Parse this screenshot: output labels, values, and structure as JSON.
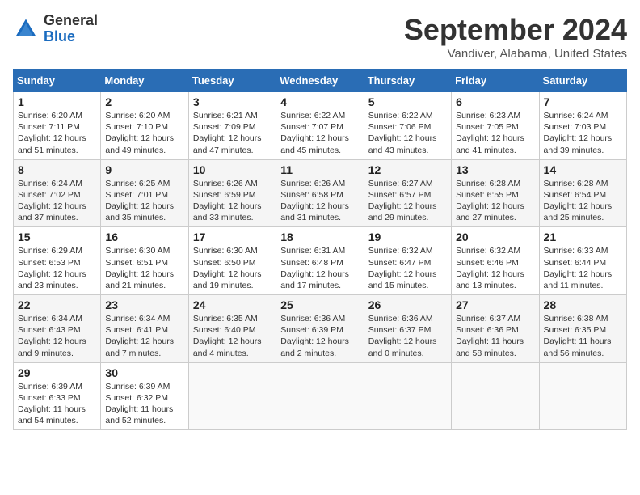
{
  "header": {
    "logo_general": "General",
    "logo_blue": "Blue",
    "month_title": "September 2024",
    "location": "Vandiver, Alabama, United States"
  },
  "calendar": {
    "days_of_week": [
      "Sunday",
      "Monday",
      "Tuesday",
      "Wednesday",
      "Thursday",
      "Friday",
      "Saturday"
    ],
    "weeks": [
      [
        {
          "day": "1",
          "sunrise": "6:20 AM",
          "sunset": "7:11 PM",
          "daylight": "12 hours and 51 minutes."
        },
        {
          "day": "2",
          "sunrise": "6:20 AM",
          "sunset": "7:10 PM",
          "daylight": "12 hours and 49 minutes."
        },
        {
          "day": "3",
          "sunrise": "6:21 AM",
          "sunset": "7:09 PM",
          "daylight": "12 hours and 47 minutes."
        },
        {
          "day": "4",
          "sunrise": "6:22 AM",
          "sunset": "7:07 PM",
          "daylight": "12 hours and 45 minutes."
        },
        {
          "day": "5",
          "sunrise": "6:22 AM",
          "sunset": "7:06 PM",
          "daylight": "12 hours and 43 minutes."
        },
        {
          "day": "6",
          "sunrise": "6:23 AM",
          "sunset": "7:05 PM",
          "daylight": "12 hours and 41 minutes."
        },
        {
          "day": "7",
          "sunrise": "6:24 AM",
          "sunset": "7:03 PM",
          "daylight": "12 hours and 39 minutes."
        }
      ],
      [
        {
          "day": "8",
          "sunrise": "6:24 AM",
          "sunset": "7:02 PM",
          "daylight": "12 hours and 37 minutes."
        },
        {
          "day": "9",
          "sunrise": "6:25 AM",
          "sunset": "7:01 PM",
          "daylight": "12 hours and 35 minutes."
        },
        {
          "day": "10",
          "sunrise": "6:26 AM",
          "sunset": "6:59 PM",
          "daylight": "12 hours and 33 minutes."
        },
        {
          "day": "11",
          "sunrise": "6:26 AM",
          "sunset": "6:58 PM",
          "daylight": "12 hours and 31 minutes."
        },
        {
          "day": "12",
          "sunrise": "6:27 AM",
          "sunset": "6:57 PM",
          "daylight": "12 hours and 29 minutes."
        },
        {
          "day": "13",
          "sunrise": "6:28 AM",
          "sunset": "6:55 PM",
          "daylight": "12 hours and 27 minutes."
        },
        {
          "day": "14",
          "sunrise": "6:28 AM",
          "sunset": "6:54 PM",
          "daylight": "12 hours and 25 minutes."
        }
      ],
      [
        {
          "day": "15",
          "sunrise": "6:29 AM",
          "sunset": "6:53 PM",
          "daylight": "12 hours and 23 minutes."
        },
        {
          "day": "16",
          "sunrise": "6:30 AM",
          "sunset": "6:51 PM",
          "daylight": "12 hours and 21 minutes."
        },
        {
          "day": "17",
          "sunrise": "6:30 AM",
          "sunset": "6:50 PM",
          "daylight": "12 hours and 19 minutes."
        },
        {
          "day": "18",
          "sunrise": "6:31 AM",
          "sunset": "6:48 PM",
          "daylight": "12 hours and 17 minutes."
        },
        {
          "day": "19",
          "sunrise": "6:32 AM",
          "sunset": "6:47 PM",
          "daylight": "12 hours and 15 minutes."
        },
        {
          "day": "20",
          "sunrise": "6:32 AM",
          "sunset": "6:46 PM",
          "daylight": "12 hours and 13 minutes."
        },
        {
          "day": "21",
          "sunrise": "6:33 AM",
          "sunset": "6:44 PM",
          "daylight": "12 hours and 11 minutes."
        }
      ],
      [
        {
          "day": "22",
          "sunrise": "6:34 AM",
          "sunset": "6:43 PM",
          "daylight": "12 hours and 9 minutes."
        },
        {
          "day": "23",
          "sunrise": "6:34 AM",
          "sunset": "6:41 PM",
          "daylight": "12 hours and 7 minutes."
        },
        {
          "day": "24",
          "sunrise": "6:35 AM",
          "sunset": "6:40 PM",
          "daylight": "12 hours and 4 minutes."
        },
        {
          "day": "25",
          "sunrise": "6:36 AM",
          "sunset": "6:39 PM",
          "daylight": "12 hours and 2 minutes."
        },
        {
          "day": "26",
          "sunrise": "6:36 AM",
          "sunset": "6:37 PM",
          "daylight": "12 hours and 0 minutes."
        },
        {
          "day": "27",
          "sunrise": "6:37 AM",
          "sunset": "6:36 PM",
          "daylight": "11 hours and 58 minutes."
        },
        {
          "day": "28",
          "sunrise": "6:38 AM",
          "sunset": "6:35 PM",
          "daylight": "11 hours and 56 minutes."
        }
      ],
      [
        {
          "day": "29",
          "sunrise": "6:39 AM",
          "sunset": "6:33 PM",
          "daylight": "11 hours and 54 minutes."
        },
        {
          "day": "30",
          "sunrise": "6:39 AM",
          "sunset": "6:32 PM",
          "daylight": "11 hours and 52 minutes."
        },
        null,
        null,
        null,
        null,
        null
      ]
    ]
  }
}
